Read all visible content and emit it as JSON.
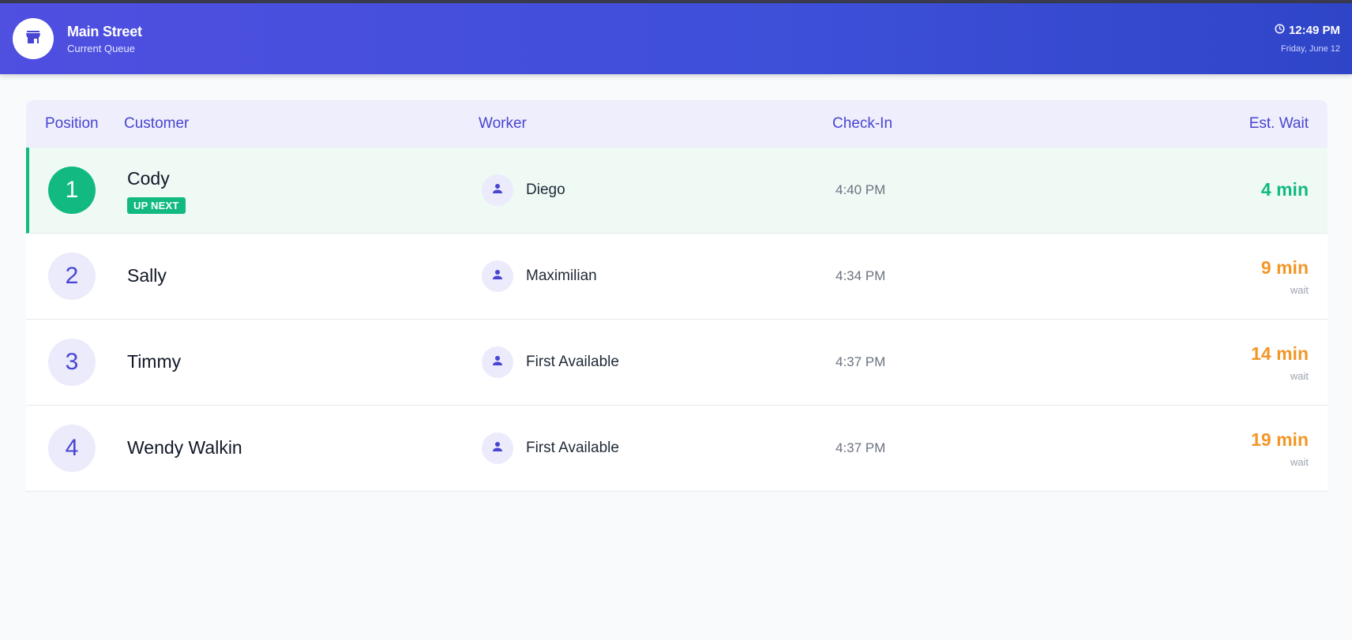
{
  "header": {
    "title": "Main Street",
    "subtitle": "Current Queue",
    "time": "12:49 PM",
    "date": "Friday, June 12"
  },
  "columns": {
    "position": "Position",
    "customer": "Customer",
    "worker": "Worker",
    "checkin": "Check-In",
    "wait": "Est. Wait"
  },
  "colors": {
    "accent": "#4845d2",
    "next": "#12b981",
    "wait": "#f29727"
  },
  "queue": [
    {
      "position": "1",
      "customer": "Cody",
      "badge": "UP NEXT",
      "worker": "Diego",
      "checkin": "4:40 PM",
      "wait": "4 min",
      "wait_label": ""
    },
    {
      "position": "2",
      "customer": "Sally",
      "badge": "",
      "worker": "Maximilian",
      "checkin": "4:34 PM",
      "wait": "9 min",
      "wait_label": "wait"
    },
    {
      "position": "3",
      "customer": "Timmy",
      "badge": "",
      "worker": "First Available",
      "checkin": "4:37 PM",
      "wait": "14 min",
      "wait_label": "wait"
    },
    {
      "position": "4",
      "customer": "Wendy Walkin",
      "badge": "",
      "worker": "First Available",
      "checkin": "4:37 PM",
      "wait": "19 min",
      "wait_label": "wait"
    }
  ]
}
